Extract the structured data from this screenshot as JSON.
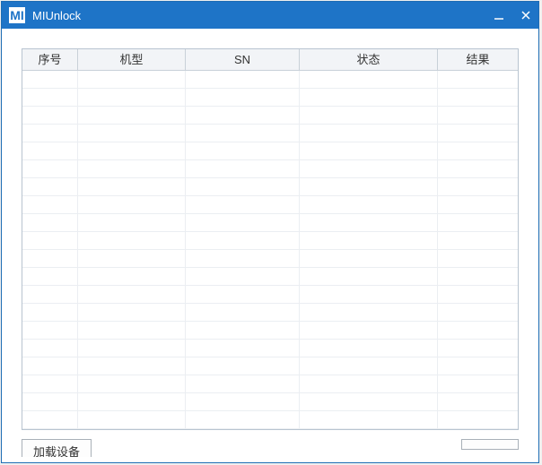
{
  "window": {
    "title": "MIUnlock",
    "logo_text": "MI"
  },
  "grid": {
    "columns": [
      {
        "label": "序号"
      },
      {
        "label": "机型"
      },
      {
        "label": "SN"
      },
      {
        "label": "状态"
      },
      {
        "label": "结果"
      }
    ],
    "rows": []
  },
  "footer": {
    "load_button": "加载设备"
  }
}
